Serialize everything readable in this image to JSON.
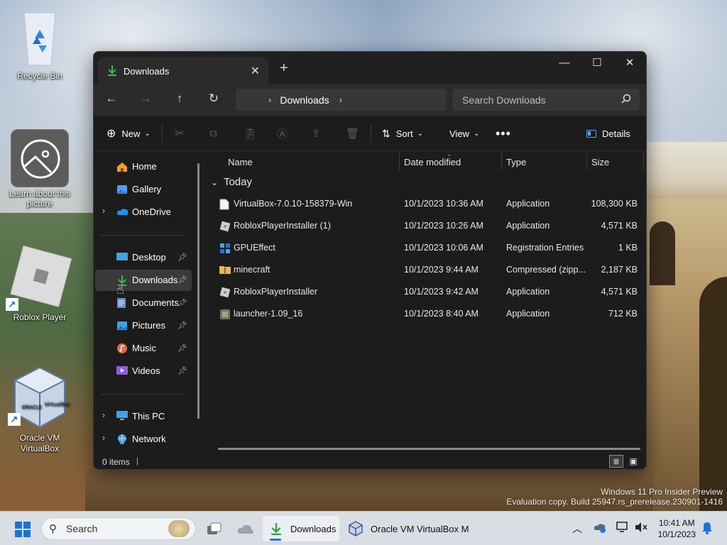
{
  "desktop": {
    "icons": [
      {
        "label": "Recycle Bin"
      },
      {
        "label": "Learn about this picture"
      },
      {
        "label": "Roblox Player"
      },
      {
        "label": "Oracle VM VirtualBox"
      }
    ],
    "watermark": {
      "line1": "Windows 11 Pro Insider Preview",
      "line2": "Evaluation copy. Build 25947.rs_prerelease.230901-1416"
    }
  },
  "window": {
    "tab": {
      "label": "Downloads"
    },
    "address": {
      "path": "Downloads"
    },
    "search": {
      "placeholder": "Search Downloads"
    },
    "toolbar": {
      "new_label": "New",
      "sort_label": "Sort",
      "view_label": "View",
      "details_label": "Details"
    },
    "sidebar": {
      "items": [
        {
          "label": "Home",
          "icon": "home-icon"
        },
        {
          "label": "Gallery",
          "icon": "gallery-icon"
        },
        {
          "label": "OneDrive",
          "icon": "onedrive-icon"
        },
        {
          "label": "Desktop",
          "icon": "desktop-icon"
        },
        {
          "label": "Downloads",
          "icon": "download-icon"
        },
        {
          "label": "Documents",
          "icon": "documents-icon"
        },
        {
          "label": "Pictures",
          "icon": "pictures-icon"
        },
        {
          "label": "Music",
          "icon": "music-icon"
        },
        {
          "label": "Videos",
          "icon": "videos-icon"
        },
        {
          "label": "This PC",
          "icon": "pc-icon"
        },
        {
          "label": "Network",
          "icon": "network-icon"
        }
      ]
    },
    "columns": {
      "name": "Name",
      "date": "Date modified",
      "type": "Type",
      "size": "Size"
    },
    "group": "Today",
    "files": [
      {
        "name": "VirtualBox-7.0.10-158379-Win",
        "date": "10/1/2023 10:36 AM",
        "type": "Application",
        "size": "108,300 KB",
        "icon": "file-icon"
      },
      {
        "name": "RobloxPlayerInstaller (1)",
        "date": "10/1/2023 10:26 AM",
        "type": "Application",
        "size": "4,571 KB",
        "icon": "roblox-icon"
      },
      {
        "name": "GPUEffect",
        "date": "10/1/2023 10:06 AM",
        "type": "Registration Entries",
        "size": "1 KB",
        "icon": "registry-icon"
      },
      {
        "name": "minecraft",
        "date": "10/1/2023 9:44 AM",
        "type": "Compressed (zipp...",
        "size": "2,187 KB",
        "icon": "zip-folder-icon"
      },
      {
        "name": "RobloxPlayerInstaller",
        "date": "10/1/2023 9:42 AM",
        "type": "Application",
        "size": "4,571 KB",
        "icon": "roblox-icon"
      },
      {
        "name": "launcher-1.09_16",
        "date": "10/1/2023 8:40 AM",
        "type": "Application",
        "size": "712 KB",
        "icon": "launcher-icon"
      }
    ],
    "status": {
      "items": "0 items"
    }
  },
  "taskbar": {
    "search_label": "Search",
    "apps": [
      {
        "label": "Downloads"
      },
      {
        "label": "Oracle VM VirtualBox M"
      }
    ],
    "clock": {
      "time": "10:41 AM",
      "date": "10/1/2023"
    }
  },
  "colors": {
    "accent": "#2a6fd6",
    "window_bg": "#1c1c1c",
    "download_green": "#3fb950"
  }
}
